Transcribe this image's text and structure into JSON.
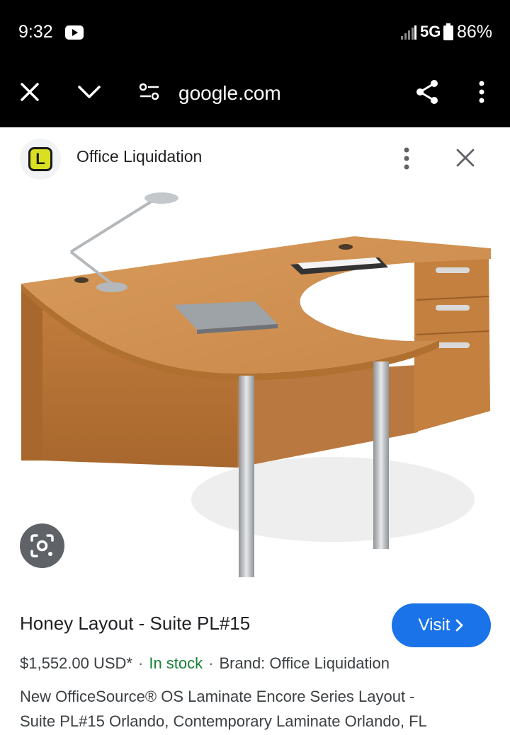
{
  "status_bar": {
    "time": "9:32",
    "network": "5G",
    "battery": "86%",
    "icons": [
      "youtube-icon",
      "signal-icon",
      "battery-icon"
    ]
  },
  "browser": {
    "url": "google.com",
    "icons": [
      "close-icon",
      "chevron-down-icon",
      "page-info-icon",
      "share-icon",
      "more-vert-icon"
    ]
  },
  "source": {
    "name": "Office Liquidation",
    "favicon_letter": "L",
    "icons": [
      "more-vert-icon",
      "close-icon"
    ]
  },
  "product": {
    "image_alt": "Honey L-shaped desk with drawers",
    "title": "Honey Layout - Suite PL#15",
    "price": "$1,552.00 USD*",
    "stock": "In stock",
    "brand": "Brand: Office Liquidation",
    "description_lines": [
      "New OfficeSource® OS Laminate Encore Series Layout -",
      "Suite PL#15 Orlando, Contemporary Laminate Orlando, FL"
    ],
    "visit_label": "Visit",
    "separator": "·"
  },
  "colors": {
    "accent": "#1a73e8",
    "stock_green": "#188038",
    "wood": "#c98a4b"
  }
}
